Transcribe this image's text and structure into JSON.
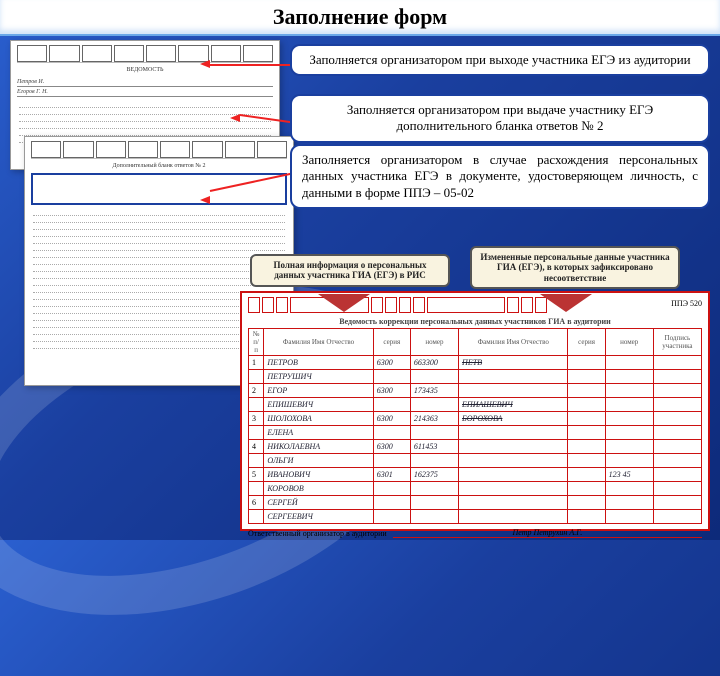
{
  "title": "Заполнение форм",
  "callouts": {
    "c1": "Заполняется организатором при выходе участника ЕГЭ из аудитории",
    "c2": "Заполняется организатором при выдаче участнику ЕГЭ дополнительного бланка ответов № 2",
    "c3": "Заполняется организатором в случае расхождения персональных данных участника ЕГЭ в документе, удостоверяющем личность, с данными в форме ППЭ – 05-02"
  },
  "column_labels": {
    "left": "Полная информация о персональных данных участника ГИА (ЕГЭ) в РИС",
    "right": "Измененные персональные данные участника ГИА (ЕГЭ), в которых зафиксировано несоответствие"
  },
  "sheet_names": [
    "Петров И.",
    "Егоров Г. Н."
  ],
  "big_form": {
    "title": "Ведомость коррекции персональных данных участников ГИА в аудитории",
    "ppe_label": "ППЭ  520",
    "col_groups": {
      "num": "№ п/п",
      "fio": "Фамилия Имя Отчество",
      "doc_ser": "серия",
      "doc_num": "номер",
      "fio2": "Фамилия Имя Отчество",
      "doc_ser2": "серия",
      "doc_num2": "номер",
      "sign": "Подпись участника"
    },
    "rows": [
      {
        "n": "1",
        "f": "ПЕТРОВ",
        "ser": "6300",
        "num": "663300",
        "f2_struck": "ПЕТВ",
        "ser2": "",
        "num2": "",
        "sig": ""
      },
      {
        "n": "",
        "f": "ПЕТРУШИЧ",
        "ser": "",
        "num": "",
        "f2_struck": "",
        "ser2": "",
        "num2": "",
        "sig": ""
      },
      {
        "n": "2",
        "f": "ЕГОР",
        "ser": "6300",
        "num": "173435",
        "f2_struck": "",
        "ser2": "",
        "num2": "",
        "sig": ""
      },
      {
        "n": "",
        "f": "ЕПИШЕВИЧ",
        "ser": "",
        "num": "",
        "f2_struck": "ЕПИАШЕВИЧ",
        "ser2": "",
        "num2": "",
        "sig": ""
      },
      {
        "n": "3",
        "f": "ШОЛОХОВА",
        "ser": "6300",
        "num": "214363",
        "f2_struck": "БОРОХОВА",
        "ser2": "",
        "num2": "",
        "sig": ""
      },
      {
        "n": "",
        "f": "ЕЛЕНА",
        "ser": "",
        "num": "",
        "f2_struck": "",
        "ser2": "",
        "num2": "",
        "sig": ""
      },
      {
        "n": "4",
        "f": "НИКОЛАЕВНА",
        "ser": "6300",
        "num": "611453",
        "f2_struck": "",
        "ser2": "",
        "num2": "",
        "sig": ""
      },
      {
        "n": "",
        "f": "ОЛЬГИ",
        "ser": "",
        "num": "",
        "f2_struck": "",
        "ser2": "",
        "num2": "",
        "sig": ""
      },
      {
        "n": "5",
        "f": "ИВАНОВИЧ",
        "ser": "6301",
        "num": "162375",
        "f2_struck": "",
        "ser2": "",
        "num2": "123 45",
        "sig": ""
      },
      {
        "n": "",
        "f": "КОРОВОВ",
        "ser": "",
        "num": "",
        "f2_struck": "",
        "ser2": "",
        "num2": "",
        "sig": ""
      },
      {
        "n": "6",
        "f": "СЕРГЕЙ",
        "ser": "",
        "num": "",
        "f2_struck": "",
        "ser2": "",
        "num2": "",
        "sig": ""
      },
      {
        "n": "",
        "f": "СЕРГЕЕВИЧ",
        "ser": "",
        "num": "",
        "f2_struck": "",
        "ser2": "",
        "num2": "",
        "sig": ""
      }
    ],
    "footer_label": "Ответственный организатор в аудитории",
    "footer_sign": "Петр   Петрухин А.Г."
  }
}
